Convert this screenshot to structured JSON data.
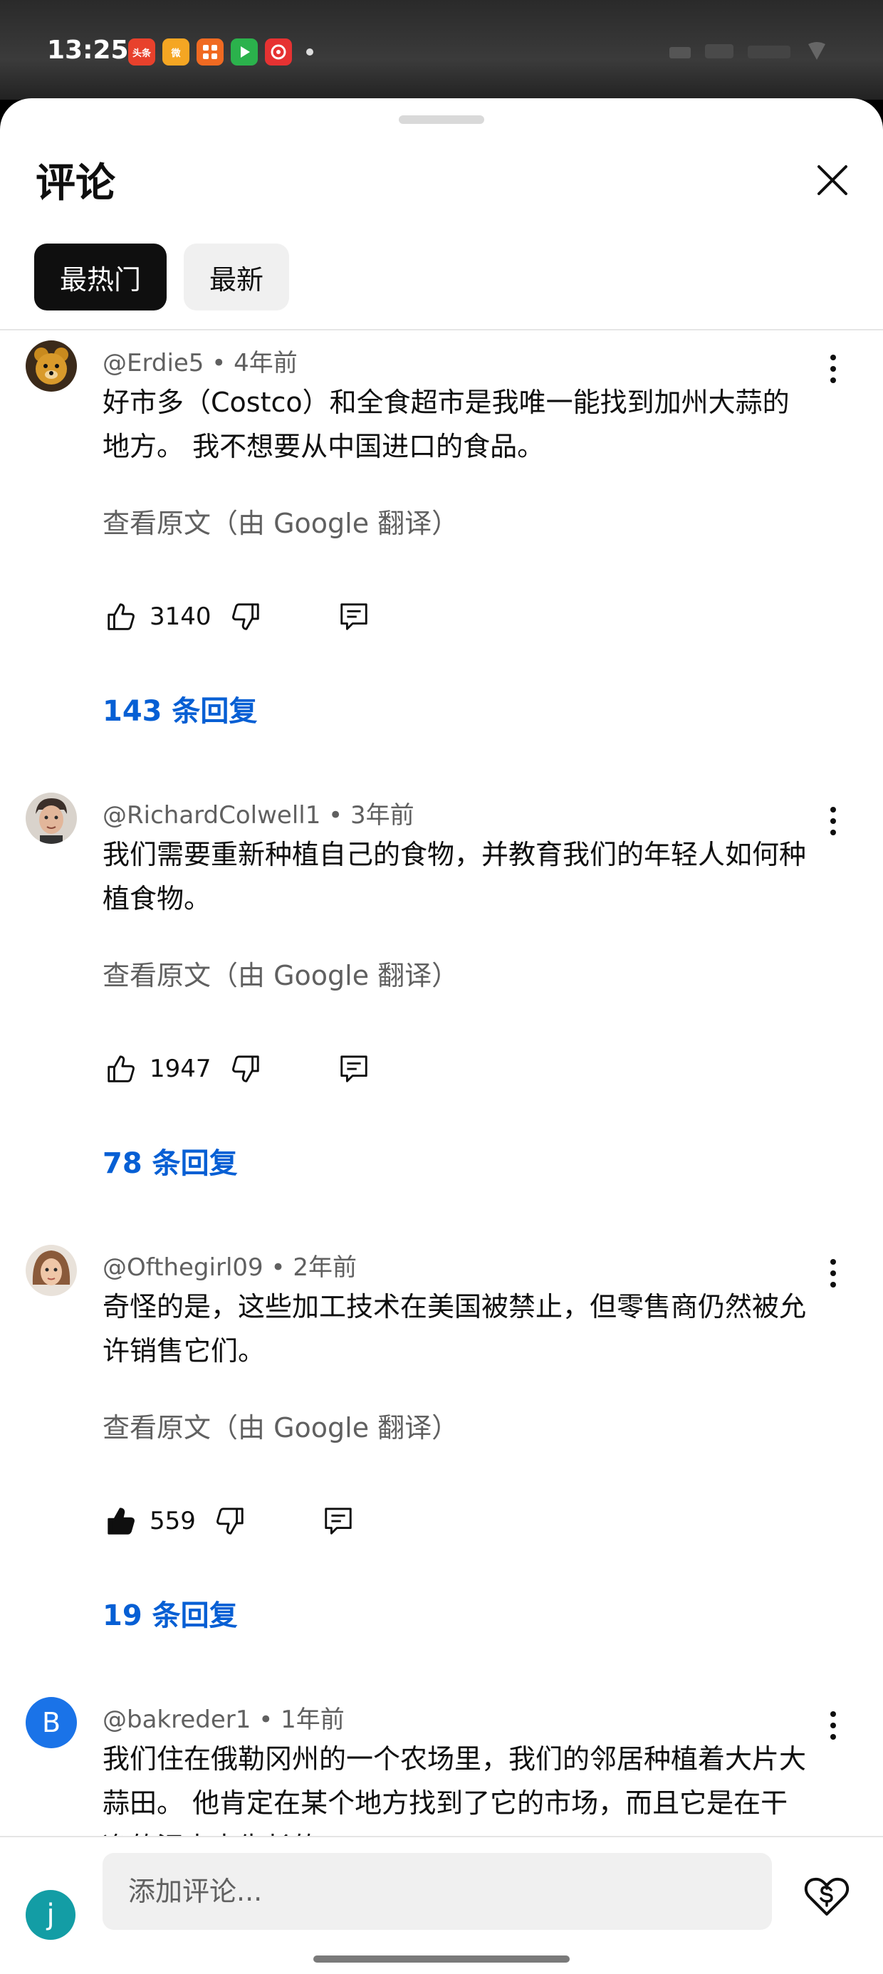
{
  "status_bar": {
    "time": "13:25",
    "apps": [
      {
        "name": "toutiao-app-icon",
        "label": "头条",
        "color": "#e8412c"
      },
      {
        "name": "weibo-app-icon",
        "label": "微",
        "color": "#f5a623"
      },
      {
        "name": "app3-icon",
        "label": "",
        "color": "#f06a22"
      },
      {
        "name": "video-app-icon",
        "label": "",
        "color": "#2bb24c"
      },
      {
        "name": "music-app-icon",
        "label": "",
        "color": "#e63232"
      }
    ]
  },
  "sheet": {
    "title": "评论",
    "tabs": [
      {
        "label": "最热门",
        "active": true
      },
      {
        "label": "最新",
        "active": false
      }
    ]
  },
  "comments": [
    {
      "author": "@Erdie5",
      "time": "4年前",
      "text": "好市多（Costco）和全食超市是我唯一能找到加州大蒜的地方。 我不想要从中国进口的食品。",
      "translate": "查看原文（由 Google 翻译）",
      "likes": "3140",
      "liked": false,
      "replies": "143 条回复",
      "avatar": {
        "type": "bear",
        "color": "#c98a1e"
      }
    },
    {
      "author": "@RichardColwell1",
      "time": "3年前",
      "text": "我们需要重新种植自己的食物，并教育我们的年轻人如何种植食物。",
      "translate": "查看原文（由 Google 翻译）",
      "likes": "1947",
      "liked": false,
      "replies": "78 条回复",
      "avatar": {
        "type": "photo",
        "color": "#5a4a44"
      }
    },
    {
      "author": "@Ofthegirl09",
      "time": "2年前",
      "text": "奇怪的是，这些加工技术在美国被禁止，但零售商仍然被允许销售它们。",
      "translate": "查看原文（由 Google 翻译）",
      "likes": "559",
      "liked": true,
      "replies": "19 条回复",
      "avatar": {
        "type": "photo",
        "color": "#b08a6a"
      }
    },
    {
      "author": "@bakreder1",
      "time": "1年前",
      "text": "我们住在俄勒冈州的一个农场里，我们的邻居种植着大片大蒜田。 他肯定在某个地方找到了它的市场，而且它是在干净的泥土中生长的。",
      "avatar": {
        "type": "letter",
        "letter": "B",
        "color": "#1a73e8"
      }
    }
  ],
  "composer": {
    "avatar_letter": "j",
    "placeholder": "添加评论..."
  }
}
